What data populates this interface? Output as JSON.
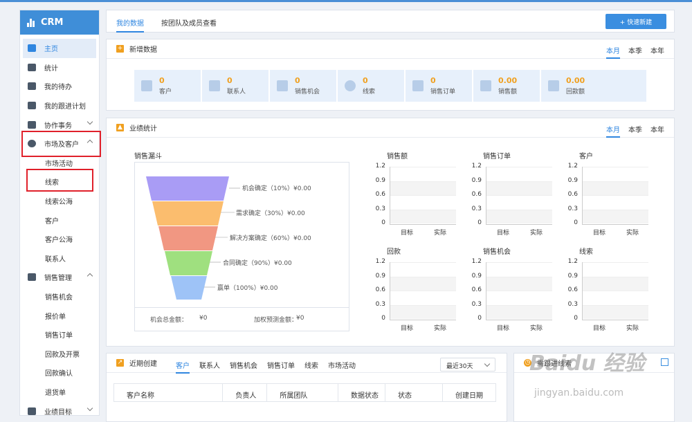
{
  "app": {
    "brand": "CRM"
  },
  "sidebar": {
    "items": [
      {
        "label": "主页",
        "icon": "home-icon",
        "active": true
      },
      {
        "label": "统计",
        "icon": "bar-chart-icon"
      },
      {
        "label": "我的待办",
        "icon": "todo-icon"
      },
      {
        "label": "我的跟进计划",
        "icon": "plan-icon"
      },
      {
        "label": "协作事务",
        "icon": "briefcase-icon",
        "chevron": "down"
      },
      {
        "label": "市场及客户",
        "icon": "pie-icon",
        "chevron": "up"
      }
    ],
    "market_sub": [
      "市场活动",
      "线索",
      "线索公海",
      "客户",
      "客户公海",
      "联系人"
    ],
    "sales_group": {
      "label": "销售管理",
      "icon": "cart-icon"
    },
    "sales_sub": [
      "销售机会",
      "报价单",
      "销售订单",
      "回款及开票",
      "回款确认",
      "退货单"
    ],
    "target_group": {
      "label": "业绩目标",
      "icon": "target-icon"
    }
  },
  "topbar": {
    "tabs": [
      "我的数据",
      "按团队及成员查看"
    ],
    "quick_add": "+ 快速新建"
  },
  "new_data": {
    "title": "新增数据",
    "periods": [
      "本月",
      "本季",
      "本年"
    ],
    "stats": [
      {
        "value": "0",
        "label": "客户"
      },
      {
        "value": "0",
        "label": "联系人"
      },
      {
        "value": "0",
        "label": "销售机会"
      },
      {
        "value": "0",
        "label": "线索"
      },
      {
        "value": "0",
        "label": "销售订单"
      },
      {
        "value": "0.00",
        "label": "销售额"
      },
      {
        "value": "0.00",
        "label": "回款额"
      }
    ]
  },
  "performance": {
    "title": "业绩统计",
    "periods": [
      "本月",
      "本季",
      "本年"
    ],
    "funnel_title": "销售漏斗",
    "funnel": [
      {
        "label": "机会确定（10%）¥0.00",
        "color": "#a99cf5"
      },
      {
        "label": "需求确定（30%）¥0.00",
        "color": "#fbbd6e"
      },
      {
        "label": "解决方案确定（60%）¥0.00",
        "color": "#f19782"
      },
      {
        "label": "合同确定（90%）¥0.00",
        "color": "#9fe07f"
      },
      {
        "label": "赢单（100%）¥0.00",
        "color": "#9ec3f7"
      }
    ],
    "total_label": "机会总金额：",
    "total_value": "¥0",
    "weighted_label": "加权预测金额：",
    "weighted_value": "¥0"
  },
  "chart_data": [
    {
      "type": "bar",
      "title": "销售额",
      "categories": [
        "目标",
        "实际"
      ],
      "values": [
        0,
        0
      ],
      "ylim": [
        0,
        1.2
      ],
      "yticks": [
        "1.2",
        "0.9",
        "0.6",
        "0.3",
        "0"
      ]
    },
    {
      "type": "bar",
      "title": "销售订单",
      "categories": [
        "目标",
        "实际"
      ],
      "values": [
        0,
        0
      ],
      "ylim": [
        0,
        1.2
      ],
      "yticks": [
        "1.2",
        "0.9",
        "0.6",
        "0.3",
        "0"
      ]
    },
    {
      "type": "bar",
      "title": "客户",
      "categories": [
        "目标",
        "实际"
      ],
      "values": [
        0,
        0
      ],
      "ylim": [
        0,
        1.2
      ],
      "yticks": [
        "1.2",
        "0.9",
        "0.6",
        "0.3",
        "0"
      ]
    },
    {
      "type": "bar",
      "title": "回款",
      "categories": [
        "目标",
        "实际"
      ],
      "values": [
        0,
        0
      ],
      "ylim": [
        0,
        1.2
      ],
      "yticks": [
        "1.2",
        "0.9",
        "0.6",
        "0.3",
        "0"
      ]
    },
    {
      "type": "bar",
      "title": "销售机会",
      "categories": [
        "目标",
        "实际"
      ],
      "values": [
        0,
        0
      ],
      "ylim": [
        0,
        1.2
      ],
      "yticks": [
        "1.2",
        "0.9",
        "0.6",
        "0.3",
        "0"
      ]
    },
    {
      "type": "bar",
      "title": "线索",
      "categories": [
        "目标",
        "实际"
      ],
      "values": [
        0,
        0
      ],
      "ylim": [
        0,
        1.2
      ],
      "yticks": [
        "1.2",
        "0.9",
        "0.6",
        "0.3",
        "0"
      ]
    }
  ],
  "recent": {
    "title": "近期创建",
    "tabs": [
      "客户",
      "联系人",
      "销售机会",
      "销售订单",
      "线索",
      "市场活动"
    ],
    "range": "最近30天",
    "columns": [
      "客户名称",
      "负责人",
      "所属团队",
      "数据状态",
      "状态",
      "创建日期"
    ]
  },
  "followup": {
    "title": "需跟进线索"
  },
  "watermark": {
    "main": "Baidu 经验",
    "sub": "jingyan.baidu.com"
  }
}
